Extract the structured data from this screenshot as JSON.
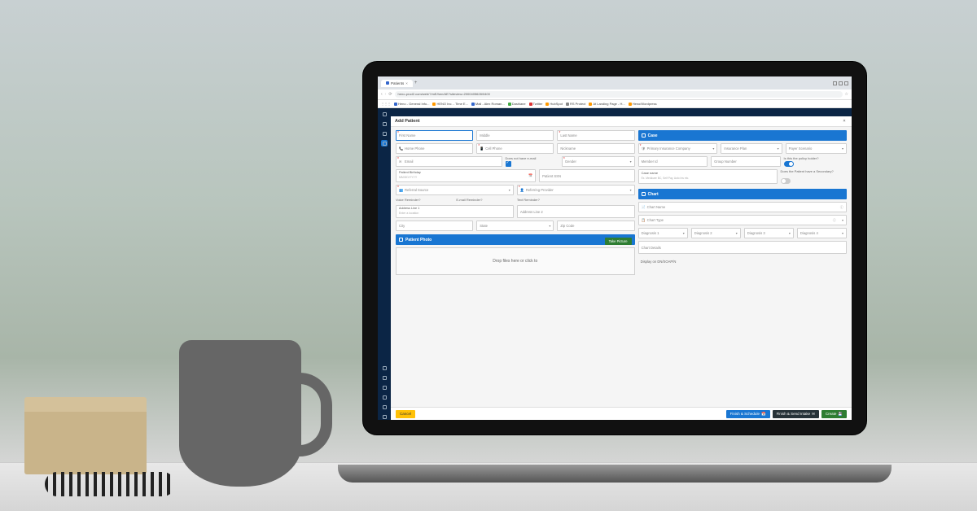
{
  "browser": {
    "tab_title": "Patients",
    "url": "heno-prod2.com/web/?/mE/hen/AE?siteview=2000405628/0400",
    "bookmarks": [
      "Heno - General Info...",
      "HENO Inc. - Time E...",
      "Mail - Alex Roman...",
      "Dashlane",
      "Twitter",
      "HubSpot",
      "RS Protect",
      "At Landing Page - H...",
      "Heno/Wordpress"
    ]
  },
  "app": {
    "nav_items": [
      "home",
      "calendar",
      "patients",
      "search",
      "reports",
      "settings",
      "billing",
      "docs",
      "users",
      "help"
    ]
  },
  "modal": {
    "title": "Add Patient",
    "fields": {
      "first_name": "First Name",
      "middle": "Middle",
      "last_name": "Last Name",
      "home_phone": "Home Phone",
      "cell_phone": "Cell Phone",
      "nickname": "Nickname",
      "email": "Email",
      "no_email": "Does not have e-mail",
      "gender": "Gender",
      "birthday_label": "Patient Birthday",
      "birthday_fmt": "MM/DD/YYYY",
      "ssn": "Patient SSN",
      "referral_source": "Referral Source",
      "referring_provider": "Referring Provider",
      "voice_reminder": "Voice Reminder?",
      "email_reminder": "E-mail Reminder?",
      "text_reminder": "Text Reminder?",
      "addr1_label": "Address Line 1",
      "addr1_hint": "Enter a location",
      "addr2": "Address Line 2",
      "city": "City",
      "state": "State",
      "zip": "Zip Code"
    },
    "case": {
      "header": "Case",
      "insurance_company": "Primary Insurance Company",
      "insurance_plan": "Insurance Plan",
      "payer_scenario": "Payer Scenario",
      "member_id": "Member Id",
      "group_number": "Group Number",
      "policy_holder": "Is this the policy holder?",
      "case_name": "Case name",
      "case_hint": "Ex. Medicare BC, Self Pay, Auto Ins etc.",
      "secondary": "Does the Patient have a Secondary?"
    },
    "chart": {
      "header": "Chart",
      "name": "Chart Name",
      "type": "Chart Type",
      "dx1": "Diagnosis 1",
      "dx2": "Diagnosis 2",
      "dx3": "Diagnosis 3",
      "dx4": "Diagnosis 4",
      "details": "Chart Details",
      "display": "Display on DN/SOAP/N"
    },
    "photo": {
      "header": "Patient Photo",
      "take": "Take Picture",
      "drop": "Drop files here or click to"
    },
    "footer": {
      "cancel": "Cancel",
      "finish_schedule": "Finish & Schedule",
      "finish_intake": "Finish & Send Intake",
      "create": "Create"
    }
  }
}
